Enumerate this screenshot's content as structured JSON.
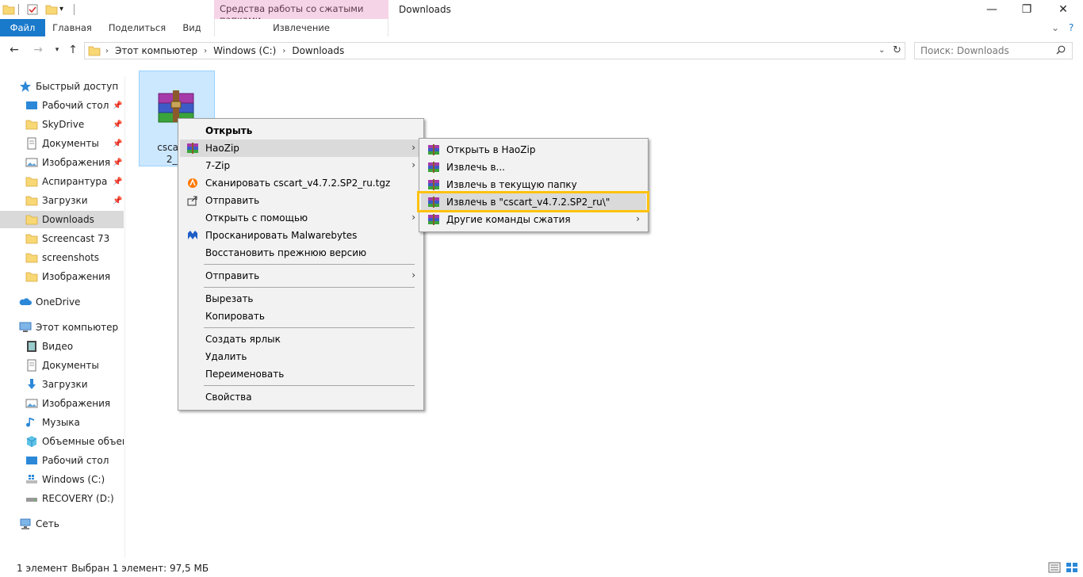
{
  "window": {
    "title": "Downloads",
    "contextual_group": "Средства работы со сжатыми папками",
    "minimize": "—",
    "maximize": "❐",
    "close": "✕"
  },
  "ribbon": {
    "tabs": [
      "Файл",
      "Главная",
      "Поделиться",
      "Вид"
    ],
    "contextual_tab": "Извлечение"
  },
  "address": {
    "segments": [
      "Этот компьютер",
      "Windows (C:)",
      "Downloads"
    ],
    "search_placeholder": "Поиск: Downloads"
  },
  "nav": {
    "quick_access": "Быстрый доступ",
    "quick_items": [
      "Рабочий стол",
      "SkyDrive",
      "Документы",
      "Изображения",
      "Аспирантура",
      "Загрузки",
      "Downloads",
      "Screencast 73",
      "screenshots",
      "Изображения"
    ],
    "onedrive": "OneDrive",
    "this_pc": "Этот компьютер",
    "pc_items": [
      "Видео",
      "Документы",
      "Загрузки",
      "Изображения",
      "Музыка",
      "Объемные объекты",
      "Рабочий стол",
      "Windows (C:)",
      "RECOVERY (D:)"
    ],
    "network": "Сеть"
  },
  "file": {
    "name_line1": "cscart_v",
    "name_line2": "2_ru"
  },
  "context_menu": {
    "items": [
      "Открыть",
      "HaoZip",
      "7-Zip",
      "Сканировать cscart_v4.7.2.SP2_ru.tgz",
      "Отправить",
      "Открыть с помощью",
      "Просканировать Malwarebytes",
      "Восстановить прежнюю версию",
      "Отправить",
      "Вырезать",
      "Копировать",
      "Создать ярлык",
      "Удалить",
      "Переименовать",
      "Свойства"
    ]
  },
  "submenu": {
    "items": [
      "Открыть в HaoZip",
      "Извлечь в...",
      "Извлечь в текущую папку",
      "Извлечь в \"cscart_v4.7.2.SP2_ru\\\"",
      "Другие команды сжатия"
    ]
  },
  "status": {
    "count": "1 элемент",
    "selected": "Выбран 1 элемент: 97,5 МБ"
  },
  "colors": {
    "accent": "#1979ca",
    "contextual_band": "#f6d4e7",
    "highlight": "#ffc20e",
    "selection": "#cce8ff"
  }
}
